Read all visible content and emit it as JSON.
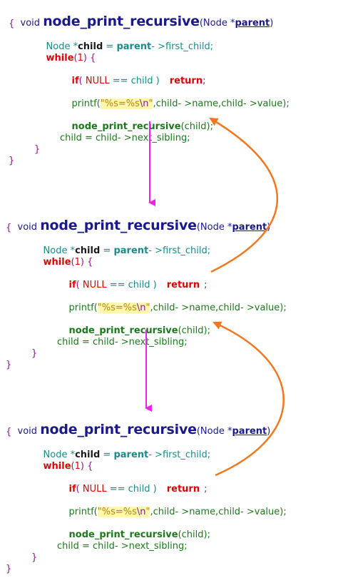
{
  "blocks": [
    {
      "void": "void ",
      "fname": "node_print_recursive",
      "sig_open": "(Node *",
      "param": "parent",
      "sig_close": ")",
      "open_brace": "{",
      "decl_type": "Node *",
      "decl_var": "child",
      "decl_eq": " = ",
      "decl_parent": "parent",
      "decl_rest": "- >first_child;",
      "while_kw": "while",
      "while_open": "(",
      "while_num": "1",
      "while_close": ") {",
      "if_kw": "if",
      "if_open": "( ",
      "if_null": "NULL",
      "if_rest": " == child )",
      "ret": "return",
      "semi": ";",
      "printf_open": "printf(",
      "fmt_q1": "\"",
      "fmt": "%s=%s",
      "fmt_nl": "\\n",
      "fmt_q2": "\"",
      "printf_rest": ",child- >name,child- >value);",
      "rec_call": "node_print_recursive",
      "rec_args": "(child);",
      "next": "child = child- >next_sibling;",
      "close_inner": "}",
      "close_outer": "}"
    },
    {
      "void": "void ",
      "fname": "node_print_recursive",
      "sig_open": "(Node *",
      "param": "parent",
      "sig_close": ")",
      "open_brace": "{",
      "decl_type": "Node *",
      "decl_var": "child",
      "decl_eq": " = ",
      "decl_parent": "parent",
      "decl_rest": "- >first_child;",
      "while_kw": "while",
      "while_open": "(",
      "while_num": "1",
      "while_close": ") {",
      "if_kw": "if",
      "if_open": "( ",
      "if_null": "NULL",
      "if_rest": " == child )",
      "ret": "return",
      "semi": ";",
      "printf_open": "printf(",
      "fmt_q1": "\"",
      "fmt": "%s=%s",
      "fmt_nl": "\\n",
      "fmt_q2": "\"",
      "printf_rest": ",child- >name,child- >value);",
      "rec_call": "node_print_recursive",
      "rec_args": "(child);",
      "next": "child = child- >next_sibling;",
      "close_inner": "}",
      "close_outer": "}"
    },
    {
      "void": "void ",
      "fname": "node_print_recursive",
      "sig_open": "(Node *",
      "param": "parent",
      "sig_close": ")",
      "open_brace": "{",
      "decl_type": "Node *",
      "decl_var": "child",
      "decl_eq": " = ",
      "decl_parent": "parent",
      "decl_rest": "- >first_child;",
      "while_kw": "while",
      "while_open": "(",
      "while_num": "1",
      "while_close": ") {",
      "if_kw": "if",
      "if_open": "( ",
      "if_null": "NULL",
      "if_rest": " == child )",
      "ret": "return",
      "semi": ";",
      "printf_open": "printf(",
      "fmt_q1": "\"",
      "fmt": "%s=%s",
      "fmt_nl": "\\n",
      "fmt_q2": "\"",
      "printf_rest": ",child- >name,child- >value);",
      "rec_call": "node_print_recursive",
      "rec_args": "(child);",
      "next": "child = child- >next_sibling;",
      "close_inner": "}",
      "close_outer": "}"
    }
  ],
  "colors": {
    "call_arrow": "#ee22ee",
    "return_arrow": "#f07820"
  }
}
